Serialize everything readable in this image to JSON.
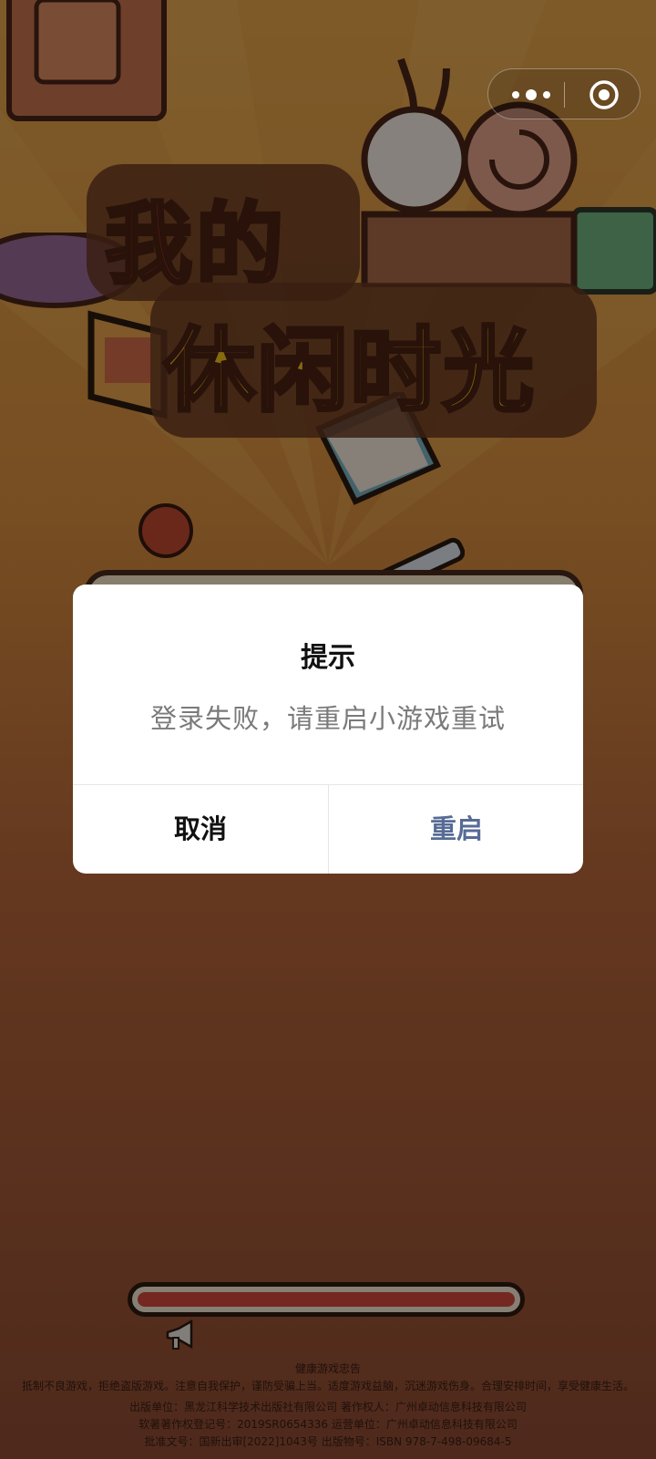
{
  "game": {
    "title_line1": "我的",
    "title_line2": "休闲时光"
  },
  "loading": {
    "progress": 1.0
  },
  "footer": {
    "heading": "健康游戏忠告",
    "advice": "抵制不良游戏，拒绝盗版游戏。注意自我保护，谨防受骗上当。适度游戏益脑，沉迷游戏伤身。合理安排时间，享受健康生活。",
    "publisher_line": "出版单位：黑龙江科学技术出版社有限公司  著作权人：广州卓动信息科技有限公司",
    "copyright_line": "软著著作权登记号：2019SR0654336  运营单位：广州卓动信息科技有限公司",
    "approval_line": "批准文号：国新出审[2022]1043号  出版物号：ISBN 978-7-498-09684-5"
  },
  "capsule": {
    "more_icon": "more-dots-icon",
    "close_icon": "target-close-icon"
  },
  "dialog": {
    "title": "提示",
    "message": "登录失败，请重启小游戏重试",
    "cancel_label": "取消",
    "confirm_label": "重启",
    "confirm_color": "#576b95"
  },
  "colors": {
    "overlay": "rgba(0,0,0,0.45)",
    "title_red": "#d23a34",
    "title_yellow": "#f2c21e",
    "progress_fill": "#d44a3c"
  }
}
